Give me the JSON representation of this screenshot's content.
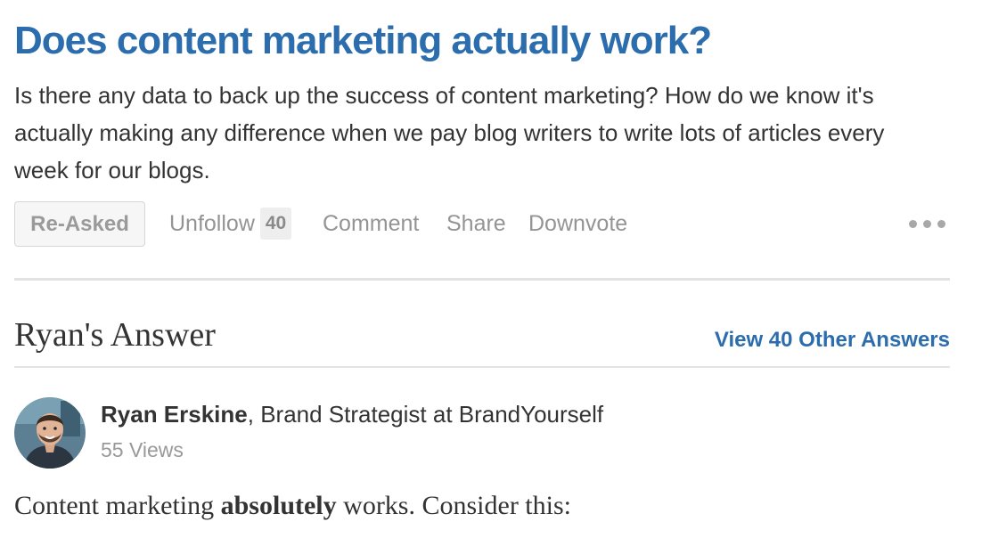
{
  "question": {
    "title": "Does content marketing actually work?",
    "details": "Is there any data to back up the success of content marketing? How do we know it's actually making any difference when we pay blog writers to write lots of articles every week for our blogs."
  },
  "actions": {
    "reasked_label": "Re-Asked",
    "unfollow_label": "Unfollow",
    "follow_count": "40",
    "comment_label": "Comment",
    "share_label": "Share",
    "downvote_label": "Downvote",
    "more_icon": "more-dots-icon"
  },
  "answer_section": {
    "heading": "Ryan's Answer",
    "view_other_label": "View 40 Other Answers"
  },
  "author": {
    "name": "Ryan Erskine",
    "separator": ", ",
    "credential": "Brand Strategist at BrandYourself",
    "views": "55 Views"
  },
  "answer": {
    "text_before": "Content marketing ",
    "text_bold": "absolutely",
    "text_after": " works. Consider this:"
  },
  "colors": {
    "link": "#2b6dad",
    "text": "#333333",
    "muted": "#949494"
  }
}
